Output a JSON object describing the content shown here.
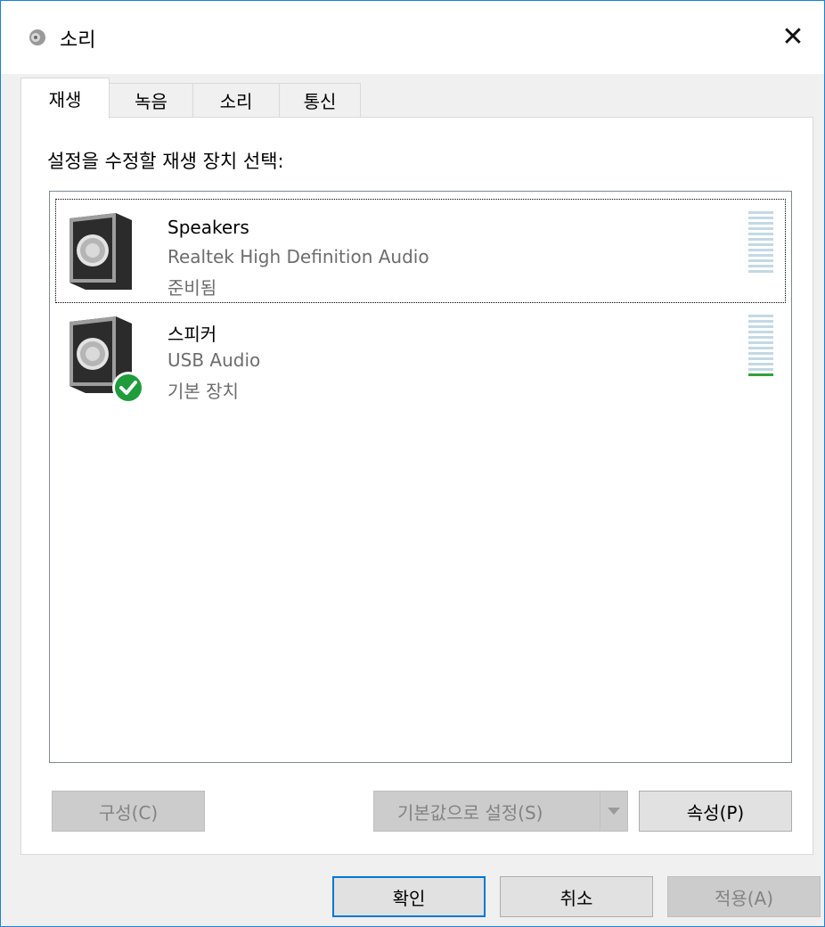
{
  "window": {
    "title": "소리",
    "close_glyph": "✕"
  },
  "tabs": [
    {
      "label": "재생",
      "active": true
    },
    {
      "label": "녹음",
      "active": false
    },
    {
      "label": "소리",
      "active": false
    },
    {
      "label": "통신",
      "active": false
    }
  ],
  "playback": {
    "instruction": "설정을 수정할 재생 장치 선택:",
    "devices": [
      {
        "name": "Speakers",
        "driver": "Realtek High Definition Audio",
        "status": "준비됨",
        "icon": "speaker-icon",
        "selected": true,
        "is_default": false,
        "level": 0
      },
      {
        "name": "스피커",
        "driver": "USB Audio",
        "status": "기본 장치",
        "icon": "speaker-icon",
        "selected": false,
        "is_default": true,
        "level": 0.08
      }
    ],
    "buttons": {
      "configure": "구성(C)",
      "set_default": "기본값으로 설정(S)",
      "properties": "속성(P)"
    }
  },
  "footer": {
    "ok": "확인",
    "cancel": "취소",
    "apply": "적용(A)"
  },
  "colors": {
    "accent": "#0078d7",
    "window_border": "#1883d7",
    "meter_idle": "#c3d9e4",
    "meter_active": "#34a13a",
    "default_badge": "#1f9c3c"
  }
}
